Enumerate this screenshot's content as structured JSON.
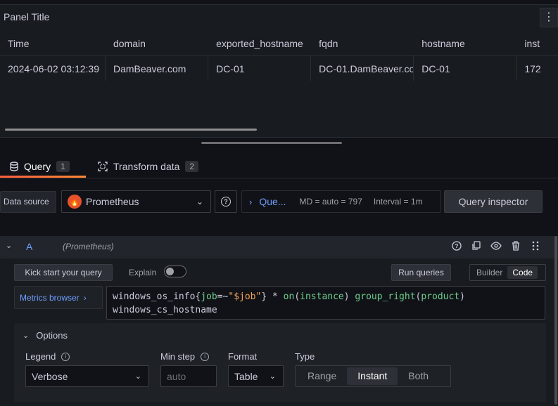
{
  "panel": {
    "title": "Panel Title",
    "menu_icon": "kebab-icon",
    "table": {
      "headers": [
        "Time",
        "domain",
        "exported_hostname",
        "fqdn",
        "hostname",
        "inst"
      ],
      "rows": [
        [
          "2024-06-02 03:12:39",
          "DamBeaver.com",
          "DC-01",
          "DC-01.DamBeaver.co",
          "DC-01",
          "172"
        ]
      ]
    }
  },
  "tabs": [
    {
      "label": "Query",
      "count": "1",
      "icon": "database-icon"
    },
    {
      "label": "Transform data",
      "count": "2",
      "icon": "transform-icon"
    }
  ],
  "toolbar": {
    "datasource_label": "Data source",
    "datasource": "Prometheus",
    "query_options_label": "Que...",
    "md": "MD = auto = 797",
    "interval": "Interval = 1m",
    "query_inspector": "Query inspector"
  },
  "query": {
    "ref_id": "A",
    "datasource": "(Prometheus)",
    "kick_start": "Kick start your query",
    "explain": "Explain",
    "run_queries": "Run queries",
    "modes": [
      "Builder",
      "Code"
    ],
    "selected_mode": "Code",
    "metrics_browser": "Metrics browser",
    "expr_line1_a": "windows_os_info{",
    "expr_line1_job": "job",
    "expr_line1_op": "=~",
    "expr_line1_str": "\"$job\"",
    "expr_line1_b": "} * ",
    "expr_on": "on",
    "expr_paren1": "(",
    "expr_instance": "instance",
    "expr_paren1c": ") ",
    "expr_group": "group_right",
    "expr_paren2": "(",
    "expr_product": "product",
    "expr_paren2c": ")",
    "expr_line2": "windows_cs_hostname"
  },
  "options": {
    "header": "Options",
    "legend_label": "Legend",
    "legend_value": "Verbose",
    "min_step_label": "Min step",
    "min_step_placeholder": "auto",
    "format_label": "Format",
    "format_value": "Table",
    "type_label": "Type",
    "type_options": [
      "Range",
      "Instant",
      "Both"
    ],
    "type_selected": "Instant"
  }
}
